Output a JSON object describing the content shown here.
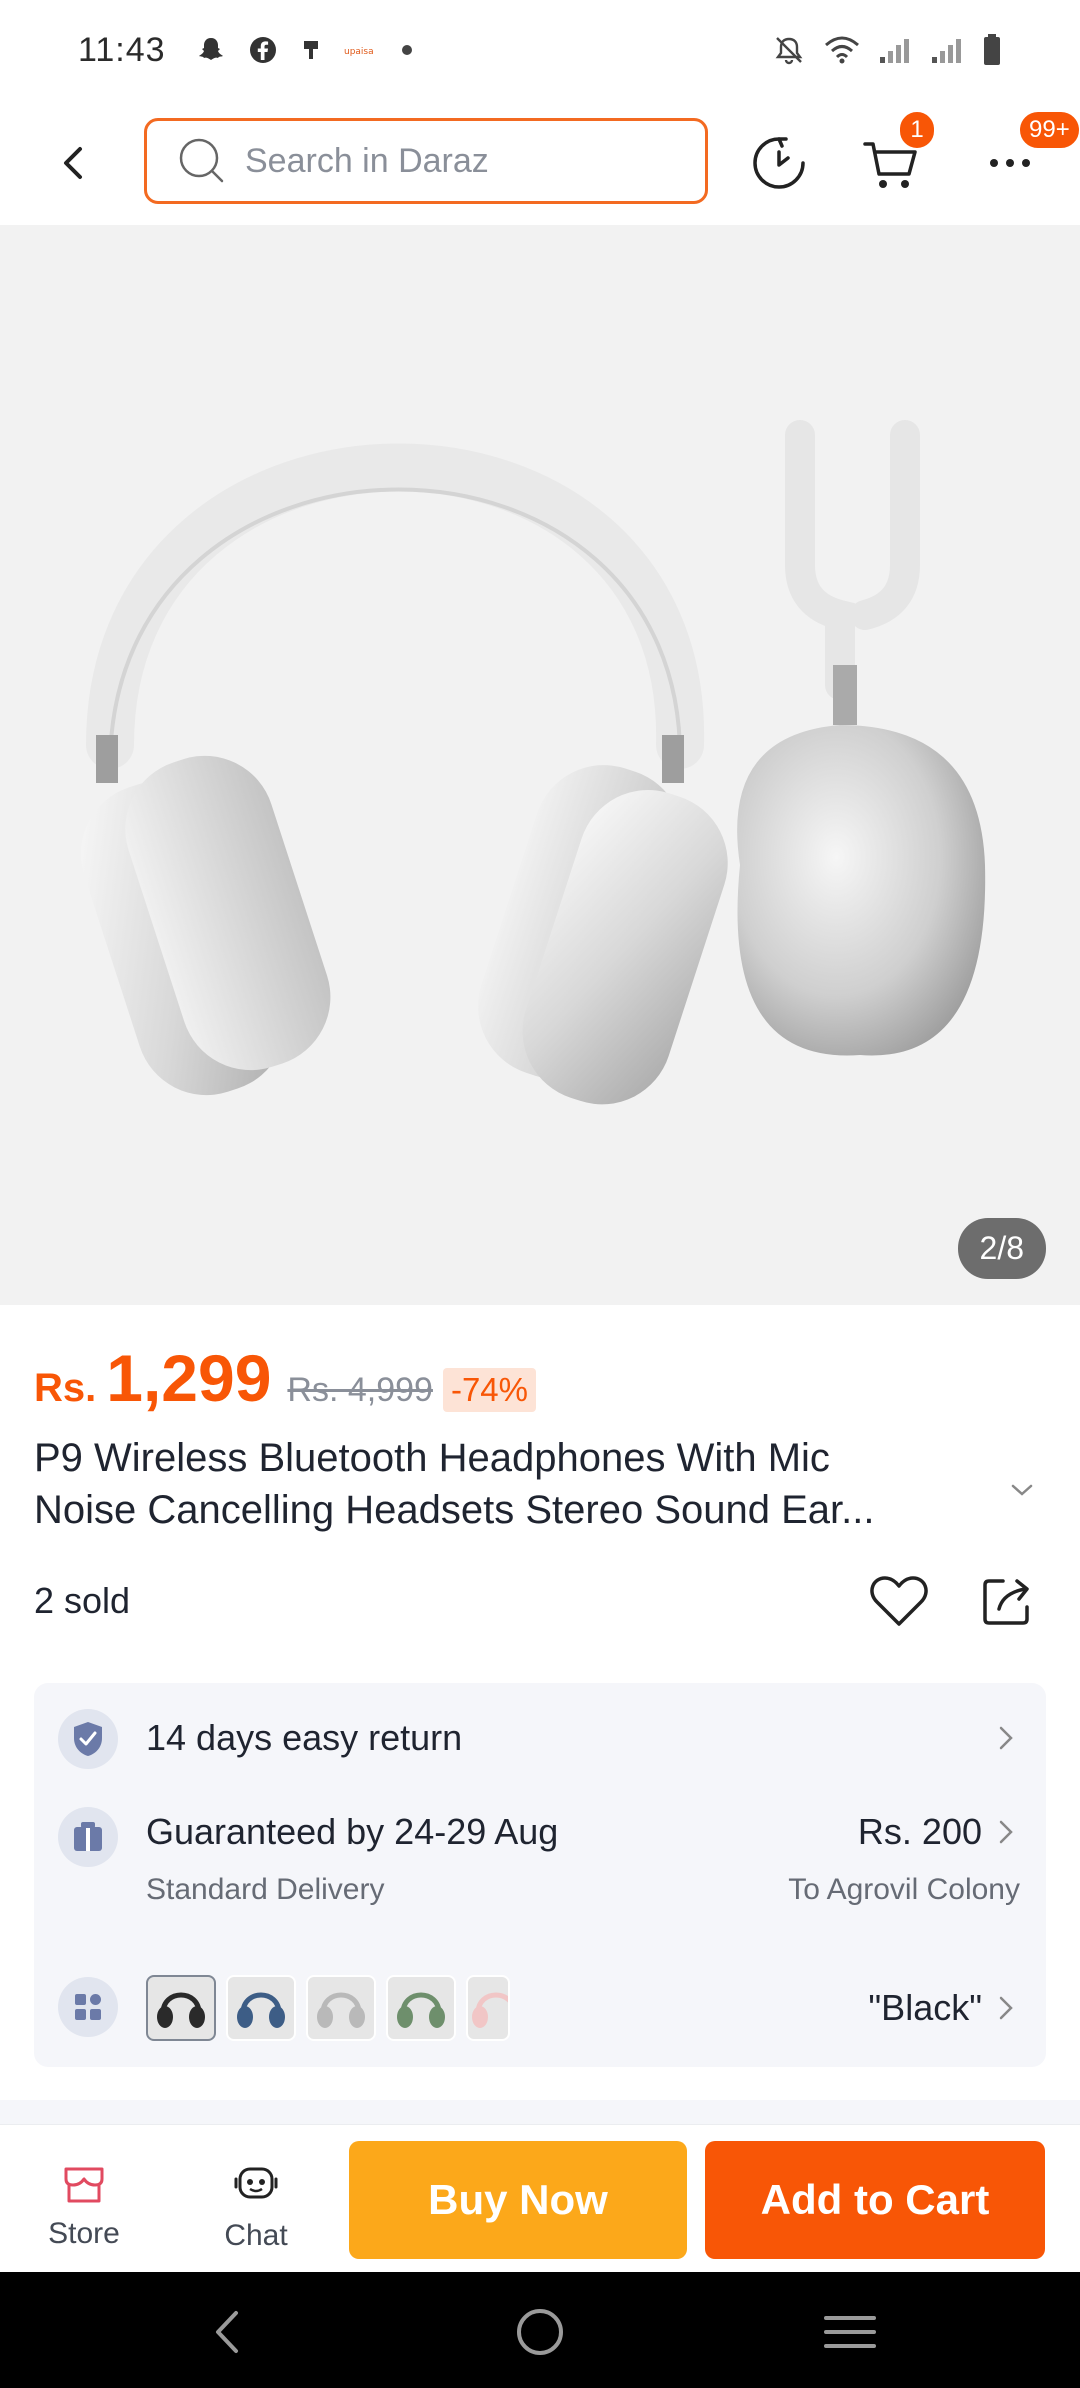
{
  "status_bar": {
    "time": "11:43",
    "icons_left": [
      "snapchat-icon",
      "facebook-icon",
      "usb-icon",
      "upaisa-icon",
      "dot-icon"
    ],
    "icons_right": [
      "mute-bell-icon",
      "wifi-icon",
      "signal-icon",
      "signal-icon",
      "battery-icon"
    ]
  },
  "header": {
    "search_placeholder": "Search in Daraz",
    "cart_badge": "1",
    "more_badge": "99+"
  },
  "gallery": {
    "counter": "2/8"
  },
  "product": {
    "currency": "Rs.",
    "price": "1,299",
    "original_price": "Rs. 4,999",
    "discount": "-74%",
    "title_line1": "P9 Wireless Bluetooth Headphones With Mic",
    "title_line2": "Noise Cancelling Headsets Stereo Sound Ear...",
    "sold": "2 sold"
  },
  "info": {
    "return_text": "14 days easy return",
    "delivery_text": "Guaranteed by 24-29 Aug",
    "delivery_sub": "Standard Delivery",
    "delivery_fee": "Rs. 200",
    "delivery_location": "To Agrovil Colony",
    "variant_selected": "\"Black\""
  },
  "bottom_bar": {
    "store_label": "Store",
    "chat_label": "Chat",
    "buy_now": "Buy Now",
    "add_to_cart": "Add to Cart"
  },
  "colors": {
    "accent": "#f85606",
    "buy_now": "#fca81a",
    "search_border": "#f36a21"
  }
}
